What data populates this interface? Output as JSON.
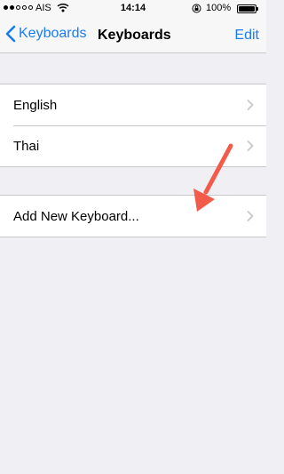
{
  "status_bar": {
    "carrier": "AIS",
    "time": "14:14",
    "battery_percent": "100%",
    "signal_bars_filled": 2,
    "signal_bars_total": 5,
    "battery_level": 1.0
  },
  "nav": {
    "back_label": "Keyboards",
    "title": "Keyboards",
    "edit_label": "Edit"
  },
  "keyboards": [
    {
      "label": "English"
    },
    {
      "label": "Thai"
    }
  ],
  "add_keyboard": {
    "label": "Add New Keyboard..."
  },
  "colors": {
    "accent": "#1a7cf3",
    "background": "#efeff4",
    "annotation_arrow": "#f25a4a"
  },
  "icons": [
    "wifi-icon",
    "rotation-lock-icon",
    "battery-icon",
    "back-chevron-icon",
    "chevron-right-icon",
    "annotation-arrow"
  ]
}
